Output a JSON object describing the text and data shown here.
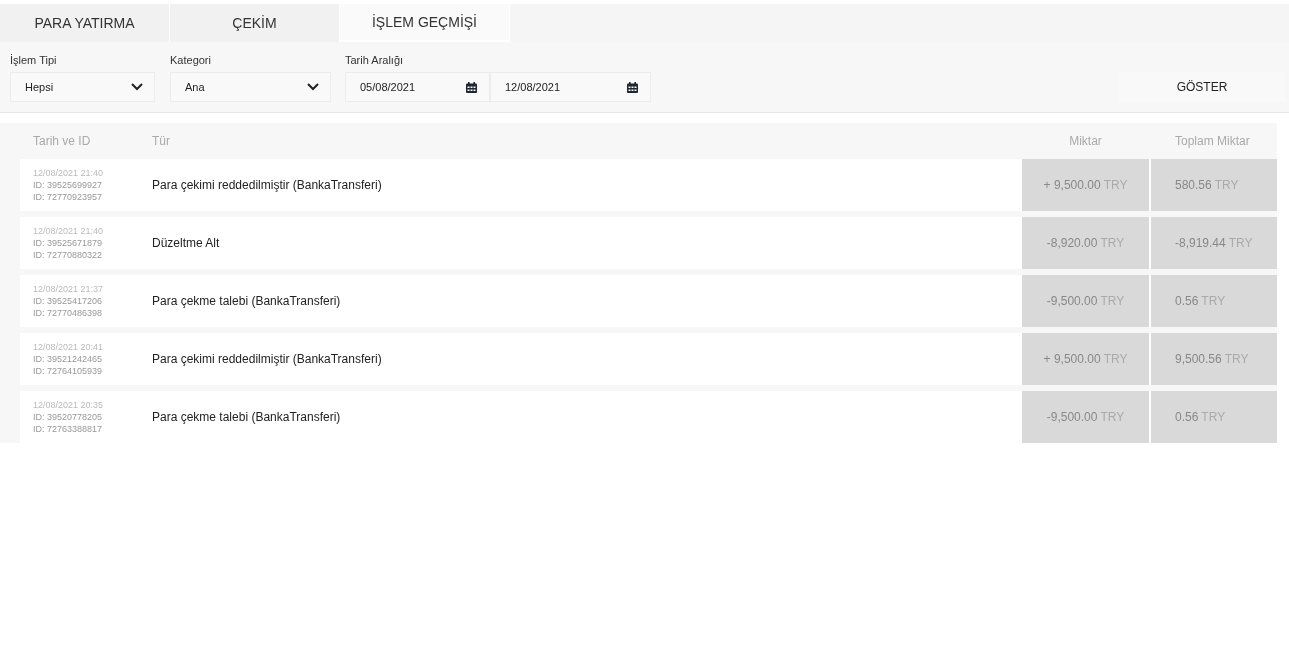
{
  "tabs": [
    {
      "label": "PARA YATIRMA",
      "selected": false
    },
    {
      "label": "ÇEKİM",
      "selected": false
    },
    {
      "label": "İŞLEM GEÇMİŞİ",
      "selected": true
    }
  ],
  "filters": {
    "type": {
      "label": "İşlem Tipi",
      "value": "Hepsi"
    },
    "category": {
      "label": "Kategori",
      "value": "Ana"
    },
    "date_range": {
      "label": "Tarih Aralığı",
      "from": "05/08/2021",
      "to": "12/08/2021"
    },
    "button": "GÖSTER"
  },
  "table": {
    "columns": [
      "Tarih ve ID",
      "Tür",
      "Miktar",
      "Toplam Miktar"
    ],
    "rows": [
      {
        "datetime": "12/08/2021 21:40",
        "ids": [
          "ID: 39525699927",
          "ID: 72770923957"
        ],
        "type": "Para çekimi reddedilmiştir (BankaTransferi)",
        "amount": "+ 9,500.00",
        "amount_currency": "TRY",
        "total": "580.56",
        "total_currency": "TRY"
      },
      {
        "datetime": "12/08/2021 21:40",
        "ids": [
          "ID: 39525671879",
          "ID: 72770880322"
        ],
        "type": "Düzeltme Alt",
        "amount": "-8,920.00",
        "amount_currency": "TRY",
        "total": "-8,919.44",
        "total_currency": "TRY"
      },
      {
        "datetime": "12/08/2021 21:37",
        "ids": [
          "ID: 39525417206",
          "ID: 72770486398"
        ],
        "type": "Para çekme talebi (BankaTransferi)",
        "amount": "-9,500.00",
        "amount_currency": "TRY",
        "total": "0.56",
        "total_currency": "TRY"
      },
      {
        "datetime": "12/08/2021 20:41",
        "ids": [
          "ID: 39521242465",
          "ID: 72764105939"
        ],
        "type": "Para çekimi reddedilmiştir (BankaTransferi)",
        "amount": "+ 9,500.00",
        "amount_currency": "TRY",
        "total": "9,500.56",
        "total_currency": "TRY"
      },
      {
        "datetime": "12/08/2021 20:35",
        "ids": [
          "ID: 39520778205",
          "ID: 72763388817"
        ],
        "type": "Para çekme talebi (BankaTransferi)",
        "amount": "-9,500.00",
        "amount_currency": "TRY",
        "total": "0.56",
        "total_currency": "TRY"
      }
    ]
  }
}
